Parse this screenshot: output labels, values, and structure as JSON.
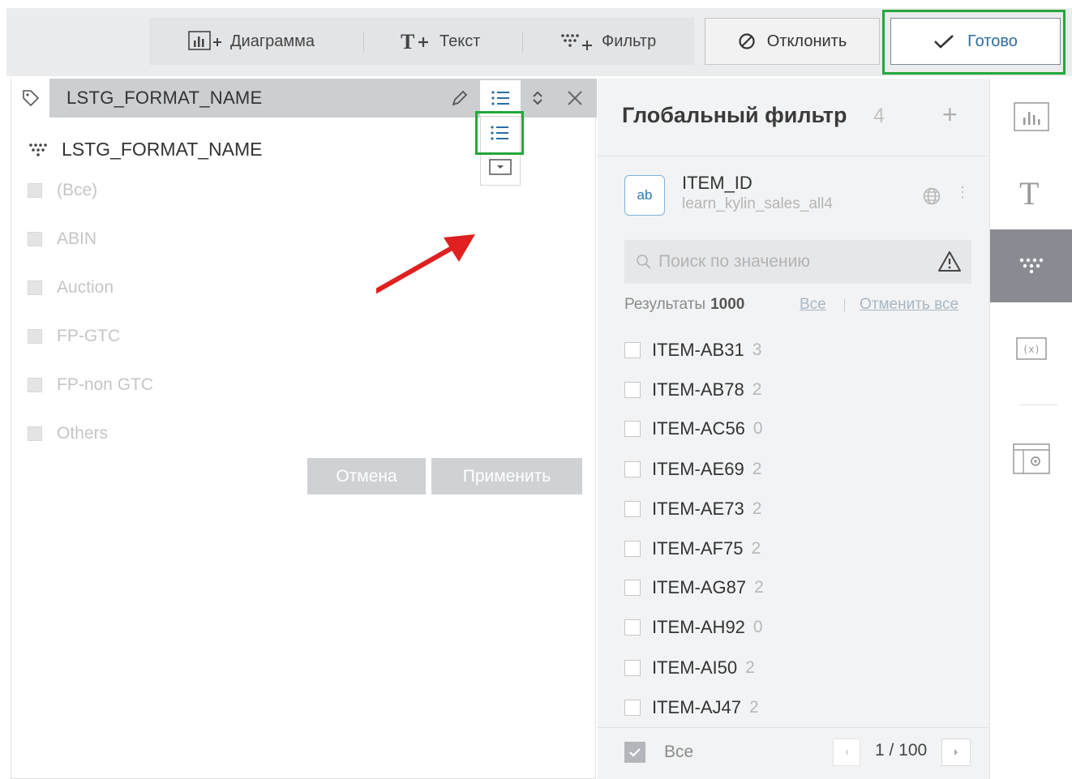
{
  "toolbar": {
    "chart_label": "Диаграмма",
    "text_label": "Текст",
    "filter_label": "Фильтр",
    "decline_label": "Отклонить",
    "done_label": "Готово"
  },
  "filter_panel": {
    "title": "LSTG_FORMAT_NAME",
    "field_name": "LSTG_FORMAT_NAME",
    "options": [
      "(Все)",
      "ABIN",
      "Auction",
      "FP-GTC",
      "FP-non GTC",
      "Others"
    ],
    "cancel_label": "Отмена",
    "apply_label": "Применить"
  },
  "global_filter": {
    "title": "Глобальный фильтр",
    "count": "4",
    "field": {
      "type_badge": "ab",
      "name": "ITEM_ID",
      "source": "learn_kylin_sales_all4"
    },
    "search_placeholder": "Поиск по значению",
    "results_label": "Результаты",
    "results_count": "1000",
    "select_all_link": "Все",
    "deselect_all_link": "Отменить все",
    "values": [
      {
        "label": "ITEM-AB31",
        "count": "3"
      },
      {
        "label": "ITEM-AB78",
        "count": "2"
      },
      {
        "label": "ITEM-AC56",
        "count": "0"
      },
      {
        "label": "ITEM-AE69",
        "count": "2"
      },
      {
        "label": "ITEM-AE73",
        "count": "2"
      },
      {
        "label": "ITEM-AF75",
        "count": "2"
      },
      {
        "label": "ITEM-AG87",
        "count": "2"
      },
      {
        "label": "ITEM-AH92",
        "count": "0"
      },
      {
        "label": "ITEM-AI50",
        "count": "2"
      },
      {
        "label": "ITEM-AJ47",
        "count": "2"
      }
    ],
    "footer_all_label": "Все",
    "pagination": "1 / 100"
  },
  "colors": {
    "highlight_green": "#22a83a",
    "arrow_red": "#e02020",
    "rail_active": "#888c92"
  }
}
